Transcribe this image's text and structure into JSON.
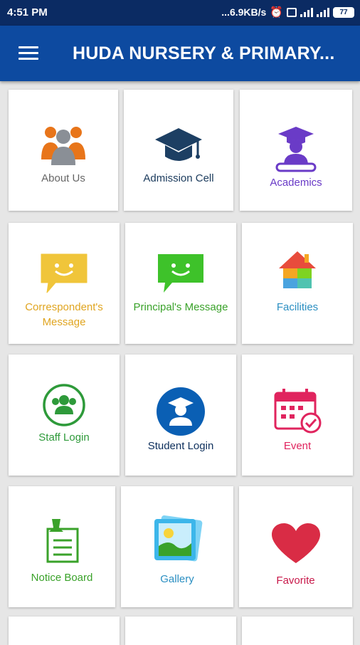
{
  "status": {
    "time": "4:51 PM",
    "net": "...6.9KB/s",
    "battery": "77"
  },
  "appbar": {
    "title": "HUDA NURSERY & PRIMARY..."
  },
  "tiles": [
    {
      "label": "About Us",
      "color": "#666666",
      "icon": "users-icon"
    },
    {
      "label": "Admission Cell",
      "color": "#1a3a5c",
      "icon": "graduation-cap-icon"
    },
    {
      "label": "Academics",
      "color": "#6a3bc7",
      "icon": "graduate-diploma-icon"
    },
    {
      "label": "Correspondent's Message",
      "color": "#e0a520",
      "icon": "message-smile-icon"
    },
    {
      "label": "Principal's Message",
      "color": "#3aa22a",
      "icon": "message-smile-icon"
    },
    {
      "label": "Facilities",
      "color": "#2b8fc2",
      "icon": "house-icon"
    },
    {
      "label": "Staff Login",
      "color": "#2e9a3a",
      "icon": "staff-icon"
    },
    {
      "label": "Student Login",
      "color": "#0d2f5c",
      "icon": "student-icon"
    },
    {
      "label": "Event",
      "color": "#e0245e",
      "icon": "calendar-icon"
    },
    {
      "label": "Notice Board",
      "color": "#3aa22a",
      "icon": "notice-board-icon"
    },
    {
      "label": "Gallery",
      "color": "#2b8fc2",
      "icon": "gallery-icon"
    },
    {
      "label": "Favorite",
      "color": "#c8194a",
      "icon": "heart-icon"
    }
  ]
}
